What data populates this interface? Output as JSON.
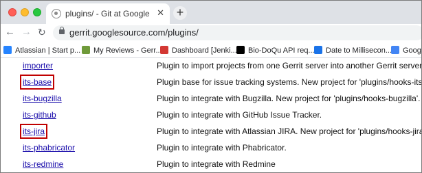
{
  "browser": {
    "tab_title": "plugins/ - Git at Google",
    "tab_close": "✕",
    "new_tab": "+",
    "url": "gerrit.googlesource.com/plugins/"
  },
  "bookmarks": [
    {
      "label": "Atlassian | Start p...",
      "icon": "atlassian-icon",
      "color": "#2684ff"
    },
    {
      "label": "My Reviews - Gerr...",
      "icon": "gerrit-icon",
      "color": "#6f9a3a"
    },
    {
      "label": "Dashboard [Jenki...",
      "icon": "jenkins-icon",
      "color": "#d33833"
    },
    {
      "label": "Bio-DoQu API req...",
      "icon": "notion-icon",
      "color": "#000000"
    },
    {
      "label": "Date to Millisecon...",
      "icon": "c-icon",
      "color": "#1a73e8"
    },
    {
      "label": "Googl",
      "icon": "google-translate-icon",
      "color": "#4285f4"
    }
  ],
  "plugins": [
    {
      "name": "importer",
      "description": "Plugin to import projects from one Gerrit server into another Gerrit server.",
      "highlighted": false
    },
    {
      "name": "its-base",
      "description": "Plugin base for issue tracking systems. New project for 'plugins/hooks-its'.",
      "highlighted": true
    },
    {
      "name": "its-bugzilla",
      "description": "Plugin to integrate with Bugzilla. New project for 'plugins/hooks-bugzilla'.",
      "highlighted": false
    },
    {
      "name": "its-github",
      "description": "Plugin to integrate with GitHub Issue Tracker.",
      "highlighted": false
    },
    {
      "name": "its-jira",
      "description": "Plugin to integrate with Atlassian JIRA. New project for 'plugins/hooks-jira'.",
      "highlighted": true
    },
    {
      "name": "its-phabricator",
      "description": "Plugin to integrate with Phabricator.",
      "highlighted": false
    },
    {
      "name": "its-redmine",
      "description": "Plugin to integrate with Redmine",
      "highlighted": false
    }
  ],
  "colors": {
    "link": "#1a0dab",
    "highlight_box": "#c00000"
  }
}
